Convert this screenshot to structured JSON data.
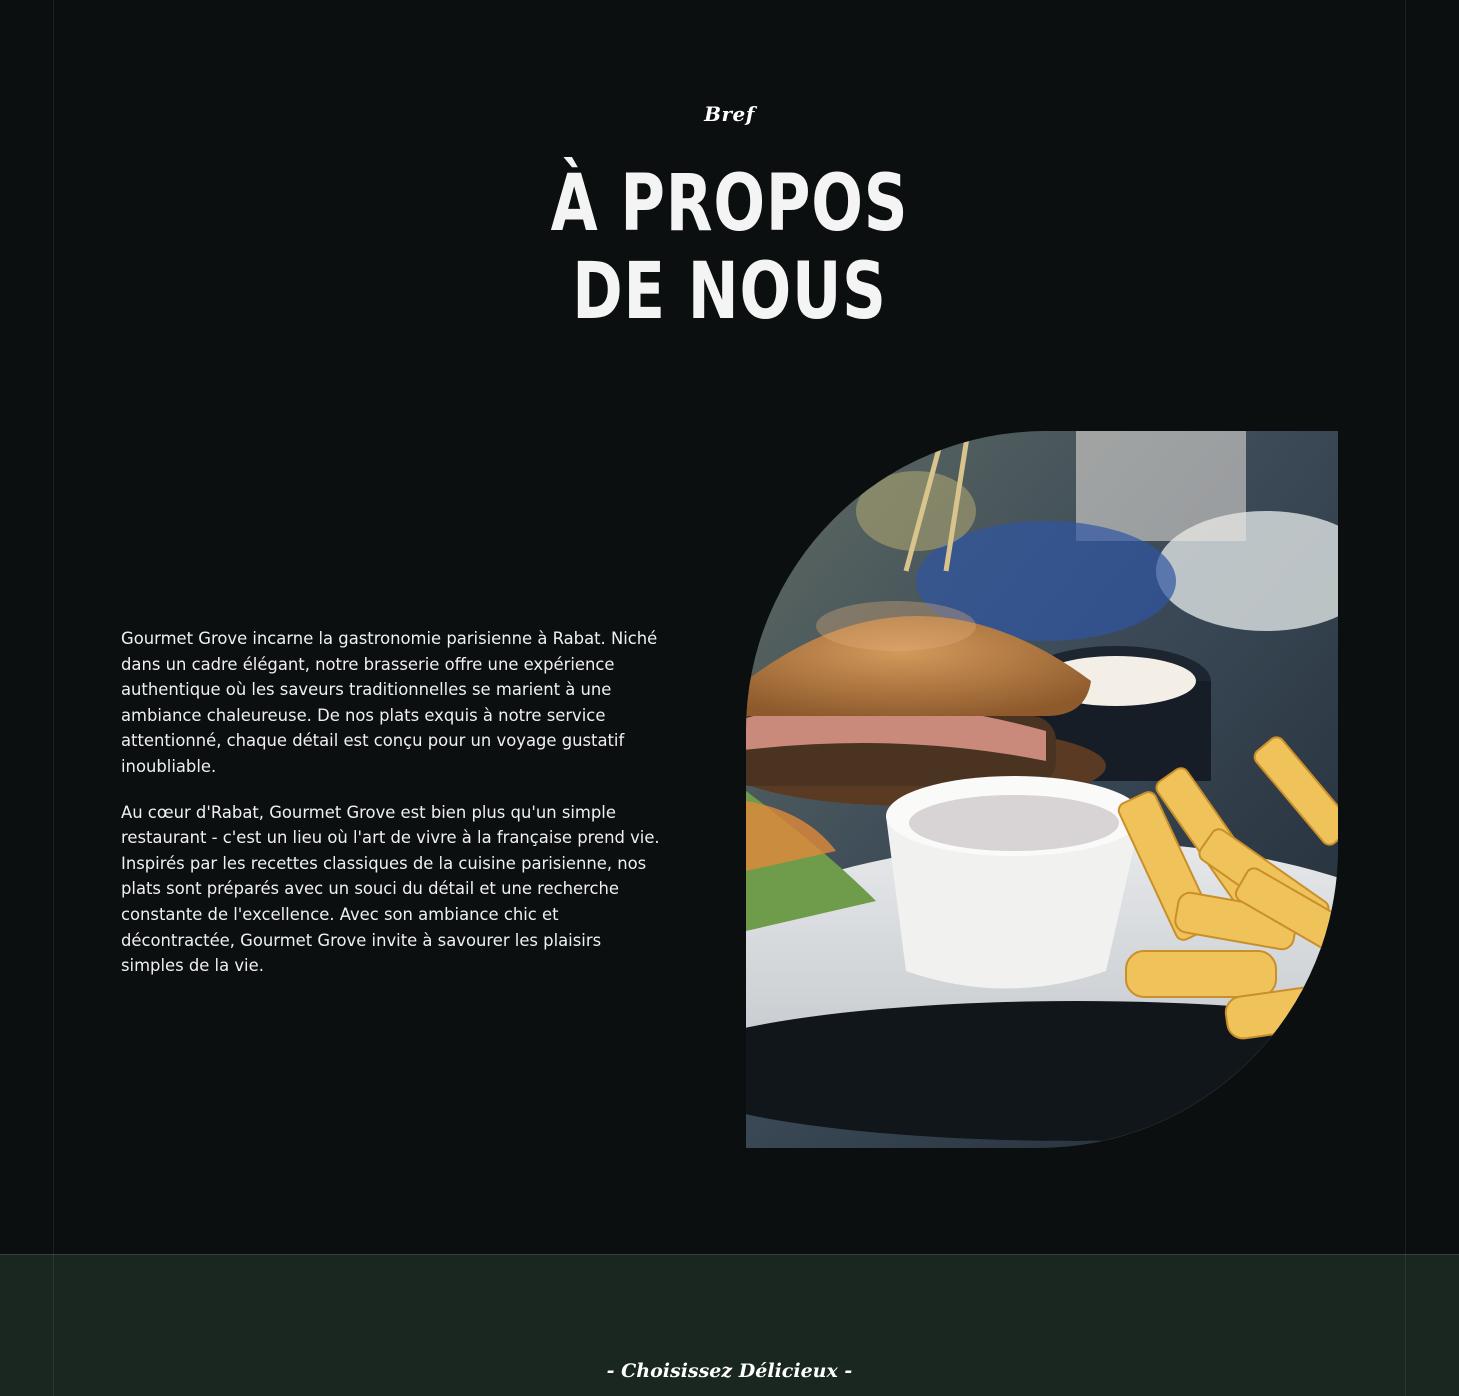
{
  "about": {
    "eyebrow": "Bref",
    "title_line1": "À PROPOS",
    "title_line2": "DE NOUS",
    "paragraphs": [
      "Gourmet Grove incarne la gastronomie parisienne à Rabat. Niché dans un cadre élégant, notre brasserie offre une expérience authentique où les saveurs traditionnelles se marient à une ambiance chaleureuse. De nos plats exquis à notre service attentionné, chaque détail est conçu pour un voyage gustatif inoubliable.",
      "Au cœur d'Rabat, Gourmet Grove est bien plus qu'un simple restaurant - c'est un lieu où l'art de vivre à la française prend vie. Inspirés par les recettes classiques de la cuisine parisienne, nos plats sont préparés avec un souci du détail et une recherche constante de l'excellence. Avec son ambiance chic et décontractée, Gourmet Grove invite à savourer les plaisirs simples de la vie."
    ]
  },
  "menu_section": {
    "eyebrow": "- Choisissez Délicieux -"
  },
  "colors": {
    "background": "#0b0f0f",
    "band": "#1a2620",
    "text": "#f2f2f2"
  }
}
